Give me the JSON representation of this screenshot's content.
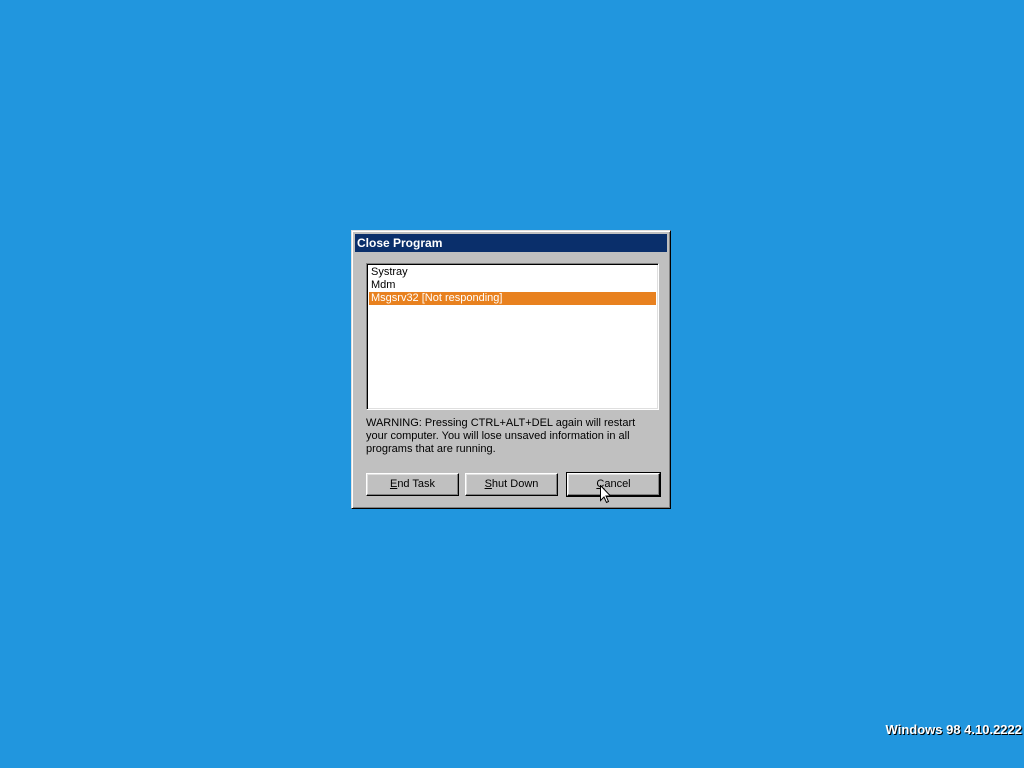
{
  "dialog": {
    "title": "Close Program",
    "list_items": [
      {
        "label": "Systray",
        "selected": false
      },
      {
        "label": "Mdm",
        "selected": false
      },
      {
        "label": "Msgsrv32 [Not responding]",
        "selected": true
      }
    ],
    "warning": "WARNING: Pressing CTRL+ALT+DEL again will restart your computer. You will lose unsaved information in all programs that are running.",
    "buttons": {
      "end_task": {
        "prefix": "",
        "accel": "E",
        "rest": "nd Task"
      },
      "shut_down": {
        "prefix": "",
        "accel": "S",
        "rest": "hut Down"
      },
      "cancel": {
        "prefix": "",
        "accel": "C",
        "rest": "ancel"
      }
    }
  },
  "desktop": {
    "version": "Windows 98 4.10.2222"
  },
  "colors": {
    "desktop": "#2196de",
    "titlebar": "#0a2f6b",
    "selection": "#e8811f"
  },
  "icons": {
    "pointer": "arrow-cursor-icon"
  }
}
